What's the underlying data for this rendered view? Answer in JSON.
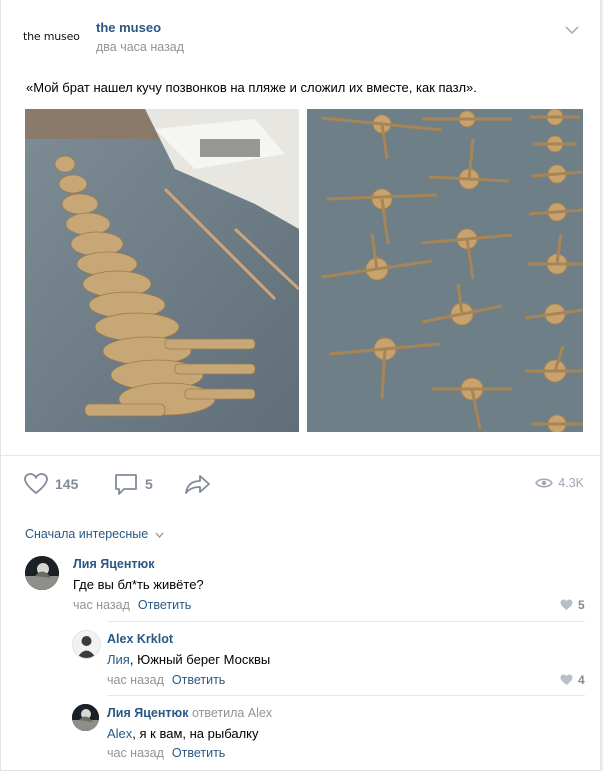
{
  "post": {
    "logo_text": "the museo",
    "author": "the museo",
    "time": "два часа назад",
    "text": "«Мой брат нашел кучу позвонков на пляже и сложил их вместе, как пазл».",
    "likes": "145",
    "comments": "5",
    "views": "4.3K"
  },
  "comments_section": {
    "sort_label": "Сначала интересные"
  },
  "comments": [
    {
      "author": "Лия Яцентюк",
      "text": "Где вы бл*ть живёте?",
      "time": "час назад",
      "reply_label": "Ответить",
      "likes": "5"
    },
    {
      "author": "Alex Krklot",
      "text_ref": "Лия",
      "text": ", Южный берег Москвы",
      "time": "час назад",
      "reply_label": "Ответить",
      "likes": "4"
    },
    {
      "author": "Лия Яцентюк",
      "replied_to": "ответила Alex",
      "text_ref": "Alex",
      "text": ", я к вам, на рыбалку",
      "time": "час назад",
      "reply_label": "Ответить"
    }
  ],
  "colors": {
    "link": "#2a5885",
    "muted": "#939393",
    "icon": "#828a99"
  }
}
